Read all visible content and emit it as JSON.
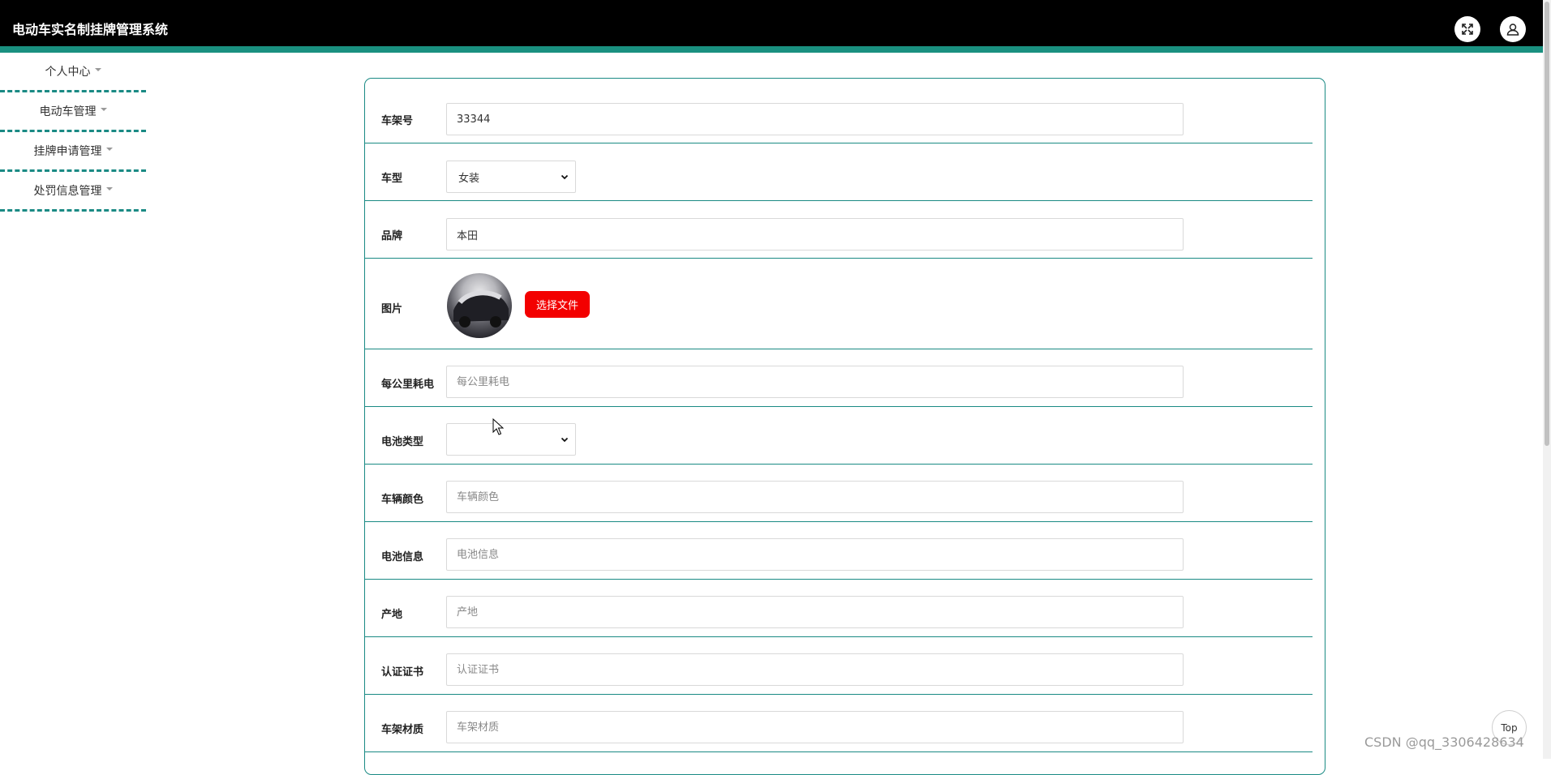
{
  "header": {
    "app_title": "电动车实名制挂牌管理系统",
    "fullscreen_icon": "fullscreen-icon",
    "user_icon": "user-icon"
  },
  "sidebar": {
    "items": [
      {
        "label": "个人中心"
      },
      {
        "label": "电动车管理"
      },
      {
        "label": "挂牌申请管理"
      },
      {
        "label": "处罚信息管理"
      }
    ]
  },
  "form": {
    "frame_no": {
      "label": "车架号",
      "value": "33344",
      "placeholder": ""
    },
    "model": {
      "label": "车型",
      "value": "女装"
    },
    "brand": {
      "label": "品牌",
      "value": "本田",
      "placeholder": ""
    },
    "image": {
      "label": "图片",
      "button_label": "选择文件"
    },
    "consumption": {
      "label": "每公里耗电",
      "value": "",
      "placeholder": "每公里耗电"
    },
    "battery_type": {
      "label": "电池类型",
      "value": ""
    },
    "color": {
      "label": "车辆颜色",
      "value": "",
      "placeholder": "车辆颜色"
    },
    "battery_info": {
      "label": "电池信息",
      "value": "",
      "placeholder": "电池信息"
    },
    "origin": {
      "label": "产地",
      "value": "",
      "placeholder": "产地"
    },
    "certificate": {
      "label": "认证证书",
      "value": "",
      "placeholder": "认证证书"
    },
    "frame_material": {
      "label": "车架材质",
      "value": "",
      "placeholder": "车架材质"
    }
  },
  "back_to_top": "Top",
  "watermark": "CSDN @qq_3306428634",
  "colors": {
    "accent": "#1a9080",
    "header": "#000000",
    "button": "#f30000"
  }
}
